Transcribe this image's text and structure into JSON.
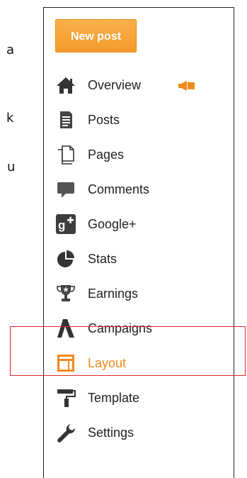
{
  "page_fragments": [
    "a",
    "k",
    "u"
  ],
  "sidebar": {
    "new_post_label": "New post",
    "items": [
      {
        "label": "Overview",
        "icon": "home-icon"
      },
      {
        "label": "Posts",
        "icon": "posts-icon"
      },
      {
        "label": "Pages",
        "icon": "pages-icon"
      },
      {
        "label": "Comments",
        "icon": "comment-icon"
      },
      {
        "label": "Google+",
        "icon": "google-plus-icon"
      },
      {
        "label": "Stats",
        "icon": "stats-icon"
      },
      {
        "label": "Earnings",
        "icon": "trophy-icon"
      },
      {
        "label": "Campaigns",
        "icon": "campaigns-icon"
      },
      {
        "label": "Layout",
        "icon": "layout-icon",
        "active": true
      },
      {
        "label": "Template",
        "icon": "template-icon"
      },
      {
        "label": "Settings",
        "icon": "wrench-icon"
      }
    ]
  },
  "colors": {
    "accent": "#f08a1c",
    "button": "#f29b2b",
    "icon": "#333333",
    "highlight_box": "#e0262d"
  }
}
